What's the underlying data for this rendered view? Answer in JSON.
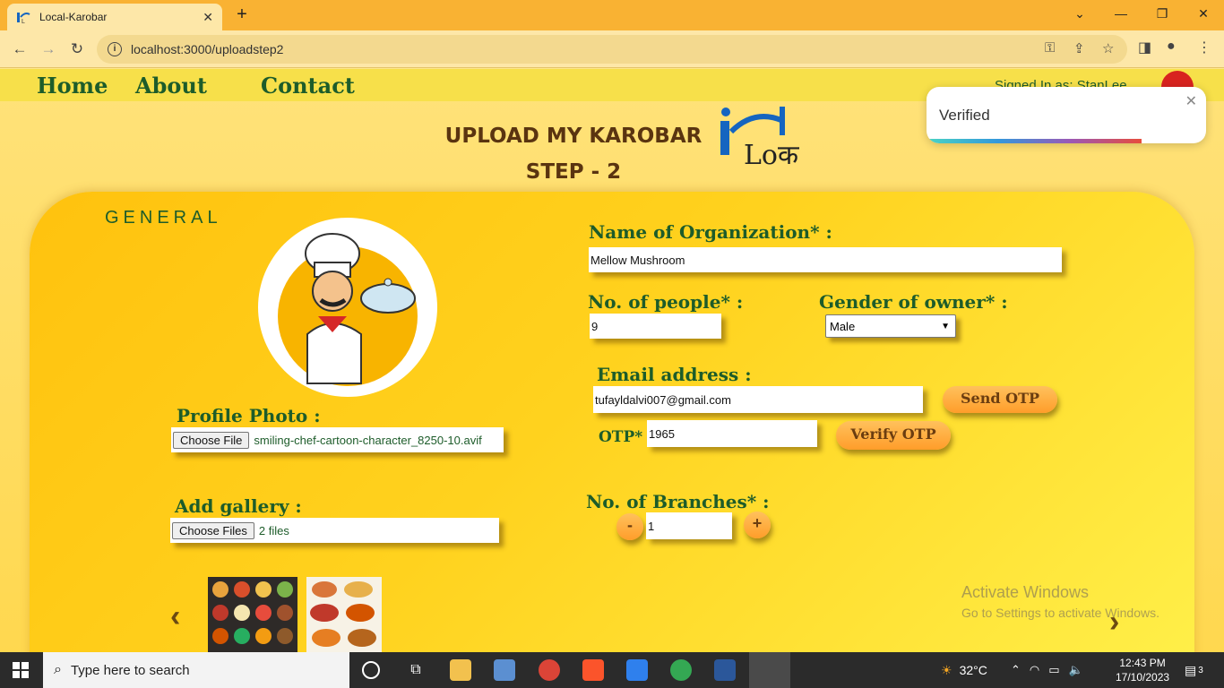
{
  "browser": {
    "tab_title": "Local-Karobar",
    "tab_close": "✕",
    "new_tab": "+",
    "url": "localhost:3000/uploadstep2",
    "win_min": "—",
    "win_restore": "❐",
    "win_close": "✕",
    "chevron": "⌄"
  },
  "nav": {
    "home": "Home",
    "about": "About",
    "contact": "Contact",
    "signed_in": "Signed In as: StanLee"
  },
  "heading": {
    "line1": "UPLOAD MY KAROBAR",
    "line2": "STEP - 2",
    "logo_text": "Loका"
  },
  "section": {
    "title": "GENERAL"
  },
  "form": {
    "profile_photo_label": "Profile Photo :",
    "profile_btn": "Choose File",
    "profile_file": "smiling-chef-cartoon-character_8250-10.avif",
    "gallery_label": "Add gallery :",
    "gallery_btn": "Choose Files",
    "gallery_files": "2 files",
    "org_label": "Name of Organization* :",
    "org_value": "Mellow Mushroom",
    "people_label": "No. of people* :",
    "people_value": "9",
    "gender_label": "Gender of owner* :",
    "gender_value": "Male",
    "email_label": "Email address :",
    "email_value": "tufayldalvi007@gmail.com",
    "send_otp": "Send OTP",
    "otp_label": "OTP* :",
    "otp_value": "1965",
    "verify_otp": "Verify OTP",
    "branches_label": "No. of Branches* :",
    "branches_value": "1",
    "minus": "-",
    "plus": "+"
  },
  "carousel": {
    "prev": "‹",
    "next": "›"
  },
  "toast": {
    "message": "Verified",
    "close": "✕",
    "progress": 0.77
  },
  "watermark": {
    "line1": "Activate Windows",
    "line2": "Go to Settings to activate Windows."
  },
  "taskbar": {
    "search_placeholder": "Type here to search",
    "weather": "32°C",
    "time": "12:43 PM",
    "date": "17/10/2023",
    "notif_count": "3"
  },
  "colors": {
    "nav_text": "#1d5c2a",
    "heading_text": "#5a3410",
    "button": "#ff9d2a"
  }
}
